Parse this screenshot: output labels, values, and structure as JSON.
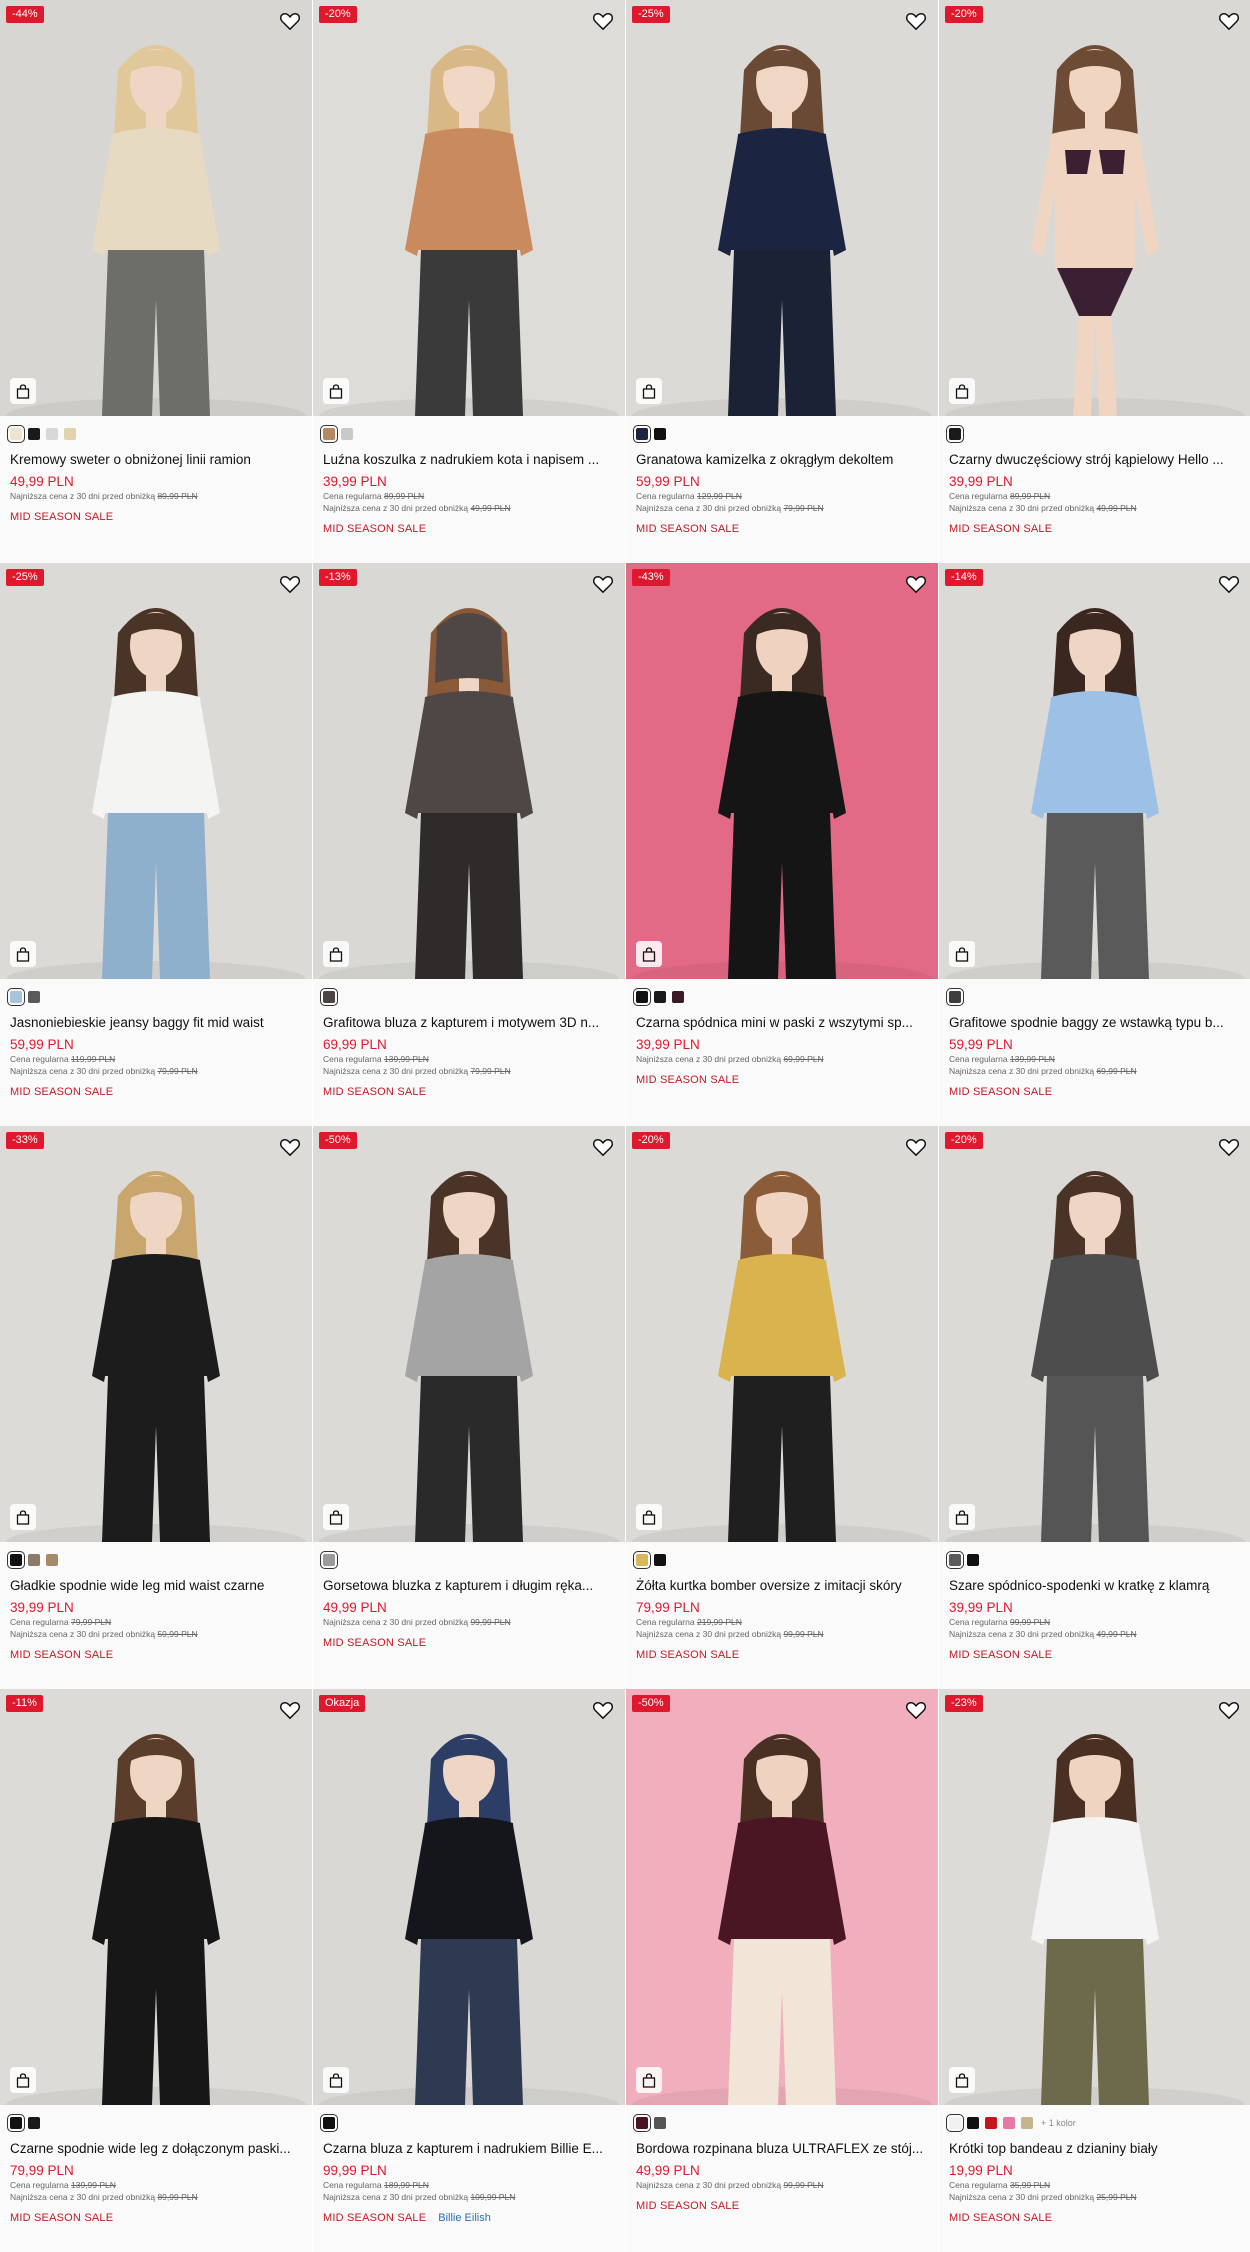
{
  "labels": {
    "regular": "Cena regularna",
    "lowest": "Najniższa cena z 30 dni przed obniżką"
  },
  "colors": {
    "accent": "#e0182d",
    "sale": "#c21a25"
  },
  "products": [
    {
      "badge": "-44%",
      "title": "Kremowy sweter o obniżonej linii ramion",
      "price": "49,99 PLN",
      "regular": "",
      "lowest": "89,99 PLN",
      "sale": "MID SEASON SALE",
      "collab": "",
      "swatches": [
        "#ece4cf",
        "#1a1a1a",
        "#d7d7d7",
        "#e3d3ad"
      ],
      "more": "",
      "bg": "#d8d6d2",
      "top": "#e6dbc2",
      "bottom": "#6d6e68",
      "skin": "#efd6c4",
      "hair": "#e1c89a"
    },
    {
      "badge": "-20%",
      "title": "Luźna koszulka z nadrukiem kota i napisem ...",
      "price": "39,99 PLN",
      "regular": "89,99 PLN",
      "lowest": "49,99 PLN",
      "sale": "MID SEASON SALE",
      "collab": "",
      "swatches": [
        "#b48961",
        "#c9c9c9"
      ],
      "more": "",
      "bg": "#dedcd9",
      "top": "#c98b5e",
      "bottom": "#3a3a3a",
      "skin": "#f1d7c6",
      "hair": "#d8b887"
    },
    {
      "badge": "-25%",
      "title": "Granatowa kamizelka z okrągłym dekoltem",
      "price": "59,99 PLN",
      "regular": "129,99 PLN",
      "lowest": "79,99 PLN",
      "sale": "MID SEASON SALE",
      "collab": "",
      "swatches": [
        "#1b2440",
        "#111111"
      ],
      "more": "",
      "bg": "#dcdad6",
      "top": "#1b2440",
      "bottom": "#1b2236",
      "skin": "#f0d6c5",
      "hair": "#6b4a35"
    },
    {
      "badge": "-20%",
      "title": "Czarny dwuczęściowy strój kąpielowy Hello ...",
      "price": "39,99 PLN",
      "regular": "89,99 PLN",
      "lowest": "49,99 PLN",
      "sale": "MID SEASON SALE",
      "collab": "",
      "swatches": [
        "#1a1a1a"
      ],
      "more": "",
      "bg": "#dad8d5",
      "top": "#3b1f33",
      "bottom": "#3b1f33",
      "skin": "#f0d5c2",
      "hair": "#6e4b35",
      "bare": true
    },
    {
      "badge": "-25%",
      "title": "Jasnoniebieskie jeansy baggy fit mid waist",
      "price": "59,99 PLN",
      "regular": "119,99 PLN",
      "lowest": "79,99 PLN",
      "sale": "MID SEASON SALE",
      "collab": "",
      "swatches": [
        "#a9c3d9",
        "#5a5a5a"
      ],
      "more": "",
      "bg": "#dcdad6",
      "top": "#f4f4f2",
      "bottom": "#8fb0cc",
      "skin": "#efd5c3",
      "hair": "#4a3427"
    },
    {
      "badge": "-13%",
      "title": "Grafitowa bluza z kapturem i motywem 3D n...",
      "price": "69,99 PLN",
      "regular": "139,99 PLN",
      "lowest": "79,99 PLN",
      "sale": "MID SEASON SALE",
      "collab": "",
      "swatches": [
        "#4b4444"
      ],
      "more": "",
      "bg": "#d9d8d5",
      "top": "#4f4646",
      "bottom": "#2f2b2b",
      "skin": "#efd5c3",
      "hair": "#8a5a38",
      "back": true
    },
    {
      "badge": "-43%",
      "title": "Czarna spódnica mini w paski z wszytymi sp...",
      "price": "39,99 PLN",
      "regular": "",
      "lowest": "69,99 PLN",
      "sale": "MID SEASON SALE",
      "collab": "",
      "swatches": [
        "#111111",
        "#1a1a1a",
        "#3c1a22"
      ],
      "more": "",
      "bg": "#e36a86",
      "top": "#151515",
      "bottom": "#151515",
      "skin": "#efd2bf",
      "hair": "#3a2a22"
    },
    {
      "badge": "-14%",
      "title": "Grafitowe spodnie baggy ze wstawką typu b...",
      "price": "59,99 PLN",
      "regular": "139,99 PLN",
      "lowest": "69,99 PLN",
      "sale": "MID SEASON SALE",
      "collab": "",
      "swatches": [
        "#3d3d3d"
      ],
      "more": "",
      "bg": "#dcdad6",
      "top": "#9cc0e6",
      "bottom": "#5a5a5a",
      "skin": "#efd5c3",
      "hair": "#3a2820"
    },
    {
      "badge": "-33%",
      "title": "Gładkie spodnie wide leg mid waist czarne",
      "price": "39,99 PLN",
      "regular": "79,99 PLN",
      "lowest": "59,99 PLN",
      "sale": "MID SEASON SALE",
      "collab": "",
      "swatches": [
        "#111111",
        "#8a7a6a",
        "#a78a6a"
      ],
      "more": "",
      "bg": "#dddbd7",
      "top": "#1c1c1c",
      "bottom": "#1c1c1c",
      "skin": "#efd6c4",
      "hair": "#c9a66e"
    },
    {
      "badge": "-50%",
      "title": "Gorsetowa bluzka z kapturem i długim ręka...",
      "price": "49,99 PLN",
      "regular": "",
      "lowest": "99,99 PLN",
      "sale": "MID SEASON SALE",
      "collab": "",
      "swatches": [
        "#9a9a9a"
      ],
      "more": "",
      "bg": "#dcdad7",
      "top": "#a4a4a4",
      "bottom": "#2a2a2a",
      "skin": "#efd5c3",
      "hair": "#4a3428"
    },
    {
      "badge": "-20%",
      "title": "Żółta kurtka bomber oversize z imitacji skóry",
      "price": "79,99 PLN",
      "regular": "219,99 PLN",
      "lowest": "99,99 PLN",
      "sale": "MID SEASON SALE",
      "collab": "",
      "swatches": [
        "#d8b65c",
        "#111111"
      ],
      "more": "",
      "bg": "#dcdad6",
      "top": "#d8b34e",
      "bottom": "#1f1f1f",
      "skin": "#efd4c2",
      "hair": "#8a5c3a"
    },
    {
      "badge": "-20%",
      "title": "Szare spódnico-spodenki w kratkę z klamrą",
      "price": "39,99 PLN",
      "regular": "99,99 PLN",
      "lowest": "49,99 PLN",
      "sale": "MID SEASON SALE",
      "collab": "",
      "swatches": [
        "#5a5a5a",
        "#111111"
      ],
      "more": "",
      "bg": "#dcdad6",
      "top": "#4d4d4d",
      "bottom": "#555555",
      "skin": "#efd5c3",
      "hair": "#4a3428"
    },
    {
      "badge": "-11%",
      "title": "Czarne spodnie wide leg z dołączonym paski...",
      "price": "79,99 PLN",
      "regular": "139,99 PLN",
      "lowest": "89,99 PLN",
      "sale": "MID SEASON SALE",
      "collab": "",
      "swatches": [
        "#111111",
        "#1a1a1a"
      ],
      "more": "",
      "bg": "#dddbd7",
      "top": "#171717",
      "bottom": "#171717",
      "skin": "#efd5c3",
      "hair": "#5a3d2a"
    },
    {
      "badge": "Okazja",
      "title": "Czarna bluza z kapturem i nadrukiem Billie E...",
      "price": "99,99 PLN",
      "regular": "189,99 PLN",
      "lowest": "109,99 PLN",
      "sale": "MID SEASON SALE",
      "collab": "Billie Eilish",
      "swatches": [
        "#111111"
      ],
      "more": "",
      "bg": "#dad8d5",
      "top": "#15151c",
      "bottom": "#2e3a52",
      "skin": "#efd5c3",
      "hair": "#2c3e66"
    },
    {
      "badge": "-50%",
      "title": "Bordowa rozpinana bluza ULTRAFLEX ze stój...",
      "price": "49,99 PLN",
      "regular": "",
      "lowest": "99,99 PLN",
      "sale": "MID SEASON SALE",
      "collab": "",
      "swatches": [
        "#4a1420",
        "#555555"
      ],
      "more": "",
      "bg": "#f1aebd",
      "top": "#4a1624",
      "bottom": "#f1e5d8",
      "skin": "#efd3c0",
      "hair": "#4a3022"
    },
    {
      "badge": "-23%",
      "title": "Krótki top bandeau z dzianiny biały",
      "price": "19,99 PLN",
      "regular": "35,99 PLN",
      "lowest": "25,99 PLN",
      "sale": "MID SEASON SALE",
      "collab": "",
      "swatches": [
        "#f1f1f1",
        "#111111",
        "#c4161c",
        "#e57aa6",
        "#c6b48f"
      ],
      "more": "+ 1 kolor",
      "bg": "#dddbd8",
      "top": "#f4f4f4",
      "bottom": "#6c6a4a",
      "skin": "#efd4c1",
      "hair": "#4a3022"
    }
  ]
}
